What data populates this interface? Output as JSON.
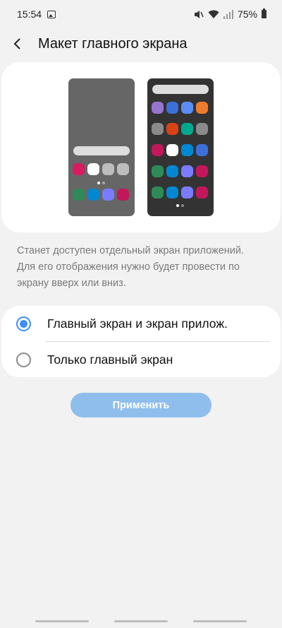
{
  "status_bar": {
    "time": "15:54",
    "battery": "75%",
    "icons": [
      "image-icon",
      "mute-icon",
      "wifi-icon",
      "signal-icon",
      "battery-icon"
    ]
  },
  "header": {
    "title": "Макет главного экрана",
    "back_icon": "chevron-left-icon"
  },
  "preview": {
    "left_phone_icon_colors": [
      "#d81b60",
      "#ffffff",
      "#bdbdbd",
      "#bdbdbd",
      "#2e8b57",
      "#0288d1",
      "#7b7bff",
      "#c2185b"
    ],
    "right_phone_icon_colors": [
      "#9575cd",
      "#3d6fd8",
      "#5c8df6",
      "#ef7b2e",
      "#8a8a8a",
      "#d84315",
      "#00a88f",
      "#8a8a8a",
      "#c2185b",
      "#ffffff",
      "#0288d1",
      "#3d6fd8",
      "#2e8b57",
      "#0288d1",
      "#7b7bff",
      "#c2185b",
      "#2e8b57",
      "#0288d1",
      "#7b7bff",
      "#c2185b"
    ]
  },
  "description": "Станет доступен отдельный экран приложений. Для его отображения нужно будет провести по экрану вверх или вниз.",
  "options": [
    {
      "label": "Главный экран и экран прилож.",
      "selected": true
    },
    {
      "label": "Только главный экран",
      "selected": false
    }
  ],
  "apply_button": "Применить",
  "colors": {
    "accent": "#3e8ef7",
    "button_disabled": "#8fbeec",
    "background": "#f2f2f2"
  }
}
